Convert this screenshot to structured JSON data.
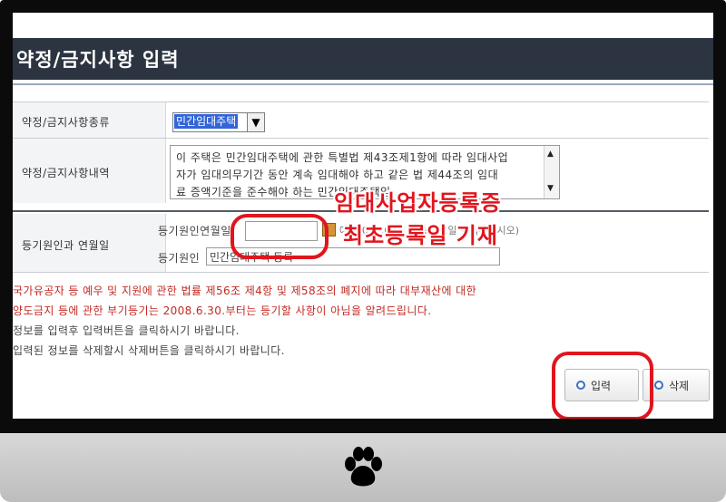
{
  "page": {
    "title": "약정/금지사항 입력"
  },
  "form": {
    "type_label": "약정/금지사항종류",
    "type_selected": "민간임대주택",
    "content_label": "약정/금지사항내역",
    "content_lines": [
      "이 주택은 민간임대주택에 관한 특별법 제43조제1항에 따라 임대사업",
      "자가 임대의무기간 동안 계속 임대해야 하고 같은 법 제44조의 임대",
      "료 증액기준을 준수해야 하는 민간임대주택임"
    ],
    "cause_row_label": "등기원인과 연월일",
    "cause_date_label": "등기원인연월일",
    "cause_date_value": "",
    "cause_date_hint": "예) 2019.01.10. (년.월.일 입력하십시오)",
    "cause_label": "등기원인",
    "cause_value": "민간임대주택 등록"
  },
  "messages": {
    "red_1": "국가유공자 등 예우 및 지원에 관한 법률 제56조 제4항 및 제58조의 폐지에 따라 대부재산에 대한",
    "red_2": "양도금지 등에 관한 부기등기는 2008.6.30.부터는 등기할 사항이 아님을 알려드립니다.",
    "info_1": "정보를 입력후 입력버튼을 클릭하시기 바랍니다.",
    "info_2": "입력된 정보를 삭제할시 삭제버튼을 클릭하시기 바랍니다."
  },
  "buttons": {
    "submit": "입력",
    "delete": "삭제"
  },
  "annotations": {
    "line_1": "임대사업자등록증",
    "line_2": "최초등록일 기재"
  },
  "icons": [
    "chevron-down-icon",
    "scroll-up-icon",
    "scroll-down-icon",
    "calendar-icon",
    "paw-icon"
  ],
  "colors": {
    "title_bar": "#2b3440",
    "warning": "#c32a24",
    "annotation": "#e0151d",
    "selection": "#3365d8"
  }
}
